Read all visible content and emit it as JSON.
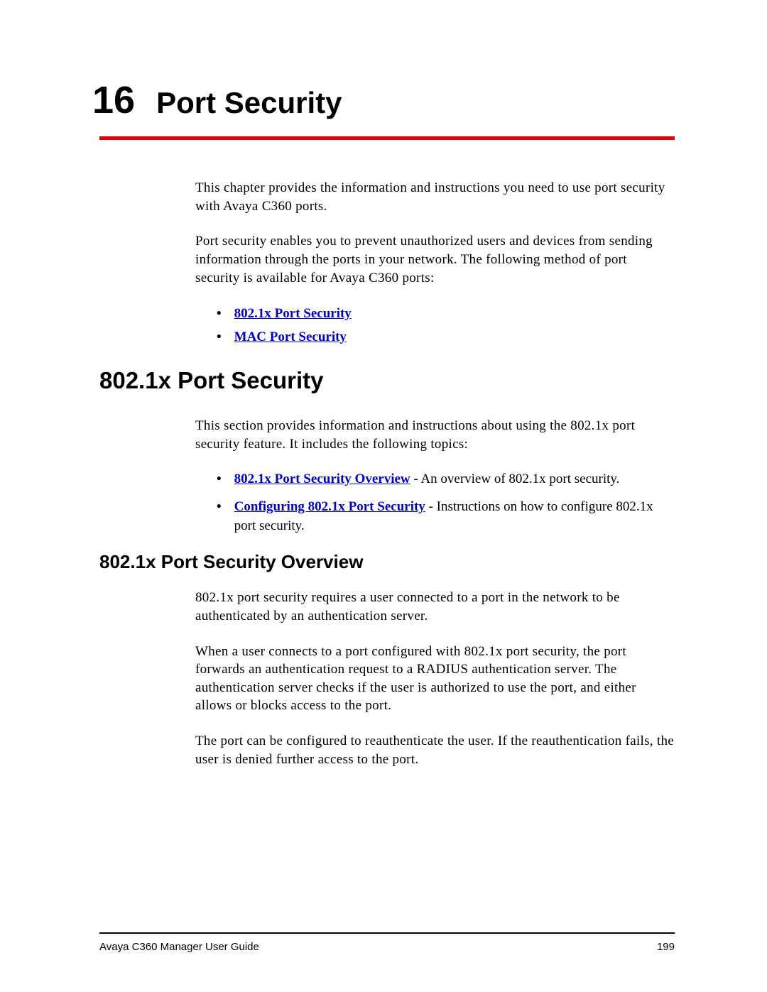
{
  "chapter": {
    "number": "16",
    "title": "Port Security"
  },
  "intro": {
    "para1": "This chapter provides the information and instructions you need to use port security with Avaya C360 ports.",
    "para2": "Port security enables you to prevent unauthorized users and devices from sending information through the ports in your network. The following method of port security is available for Avaya C360 ports:"
  },
  "intro_bullets": [
    {
      "link": "802.1x Port Security"
    },
    {
      "link": "MAC Port Security"
    }
  ],
  "section1": {
    "heading": "802.1x Port Security",
    "para1": "This section provides information and instructions about using the 802.1x port security feature. It includes the following topics:",
    "bullets": [
      {
        "link": "802.1x Port Security Overview",
        "desc": " - An overview of 802.1x port security."
      },
      {
        "link": "Configuring 802.1x Port Security",
        "desc": " - Instructions on how to configure 802.1x port security."
      }
    ]
  },
  "subsection1": {
    "heading": "802.1x Port Security Overview",
    "para1": "802.1x port security requires a user connected to a port in the network to be authenticated by an authentication server.",
    "para2": "When a user connects to a port configured with 802.1x port security, the port forwards an authentication request to a RADIUS authentication server. The authentication server checks if the user is authorized to use the port, and either allows or blocks access to the port.",
    "para3": "The port can be configured to reauthenticate the user. If the reauthentication fails, the user is denied further access to the port."
  },
  "footer": {
    "guide": "Avaya C360 Manager User Guide",
    "page": "199"
  }
}
